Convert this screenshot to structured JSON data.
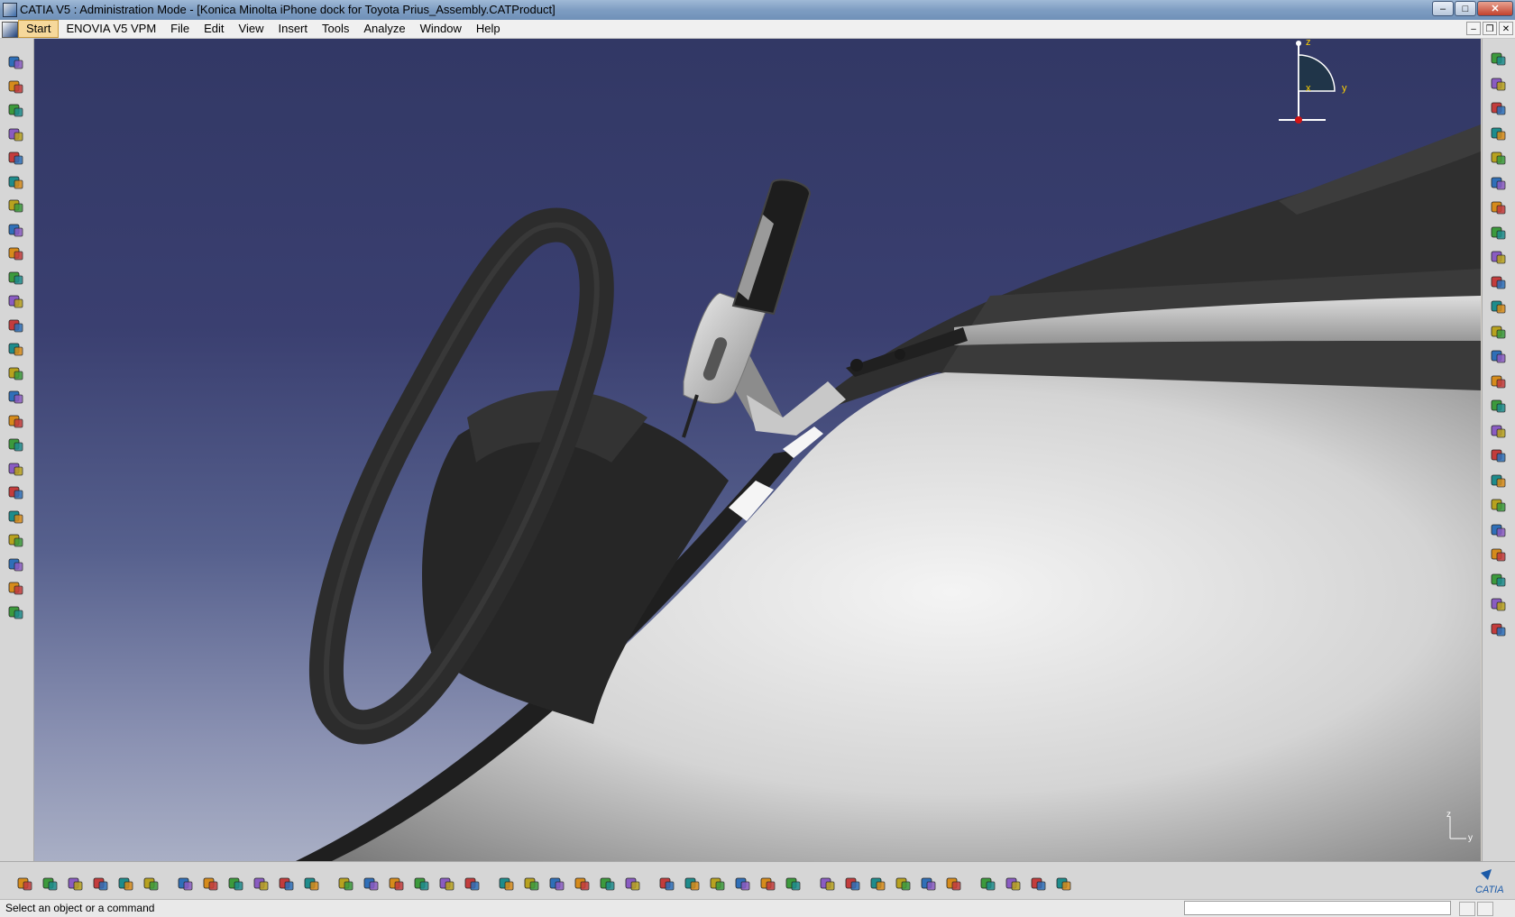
{
  "window": {
    "title": "CATIA V5 : Administration Mode - [Konica Minolta iPhone dock for Toyota Prius_Assembly.CATProduct]",
    "controls": {
      "minimize": "–",
      "maximize": "□",
      "close": "✕"
    }
  },
  "menu": {
    "items": [
      {
        "label": "Start"
      },
      {
        "label": "ENOVIA V5 VPM"
      },
      {
        "label": "File"
      },
      {
        "label": "Edit"
      },
      {
        "label": "View"
      },
      {
        "label": "Insert"
      },
      {
        "label": "Tools"
      },
      {
        "label": "Analyze"
      },
      {
        "label": "Window"
      },
      {
        "label": "Help"
      }
    ],
    "active": "Start",
    "doc_controls": {
      "minimize": "–",
      "restore": "❐",
      "close": "✕"
    }
  },
  "compass": {
    "axis_z": "z",
    "axis_x": "x",
    "axis_y": "y"
  },
  "mini_axis": {
    "z": "z",
    "y": "y"
  },
  "status": {
    "message": "Select an object or a command",
    "command_input": ""
  },
  "brand": {
    "logo_text": "CATIA"
  },
  "colors": {
    "background_top": "#323865",
    "background_bottom": "#a9afc5",
    "accent_menu": "#f6d89b",
    "toolbar": "#d6d6d6"
  },
  "left_tools": [
    "point-icon",
    "spline-icon",
    "sweep-icon",
    "eraser-icon",
    "product-icon",
    "component-icon",
    "existing-component-icon",
    "part-icon",
    "replace-icon",
    "reorder-icon",
    "ruler-icon",
    "measure-icon",
    "constraint-icon",
    "update-icon",
    "scene-icon",
    "dimension-icon",
    "text-icon",
    "flag-note-icon",
    "annotation-icon",
    "sectioning-icon",
    "catalog-icon",
    "bom-icon",
    "tree-icon",
    "links-icon"
  ],
  "right_tools": [
    "gear-icon",
    "select-arrow-icon",
    "fast-multi-instance-icon",
    "kinematics-icon",
    "assembly-icon",
    "mechanism-icon",
    "insert-icon",
    "publish-icon",
    "manipulation-icon",
    "snap-icon",
    "explode-icon",
    "smart-move-icon",
    "coincidence-icon",
    "contact-icon",
    "offset-icon",
    "angle-icon",
    "fix-icon",
    "fix-together-icon",
    "quick-constraint-icon",
    "flexible-icon",
    "reuse-pattern-icon",
    "space-analysis-icon",
    "clash-icon",
    "distance-icon"
  ],
  "bottom_tools": [
    "new-icon",
    "open-icon",
    "save-icon",
    "print-icon",
    "cut-icon",
    "copy-icon",
    "paste-icon",
    "undo-icon",
    "redo-icon",
    "whats-this-icon",
    "formula-icon",
    "comment-icon",
    "knowledge-icon",
    "table-icon",
    "design-table-icon",
    "lock-icon",
    "product-structure-icon",
    "fly-mode-icon",
    "fit-all-icon",
    "pan-icon",
    "rotate-icon",
    "zoom-in-icon",
    "zoom-out-icon",
    "normal-view-icon",
    "multi-view-icon",
    "isometric-view-icon",
    "hide-show-icon",
    "swap-visible-icon",
    "render-style-icon",
    "refresh-icon",
    "capture-icon",
    "sketch-icon",
    "grid-icon",
    "material-icon",
    "apply-material-icon",
    "lights-icon",
    "plane-icon",
    "measure-between-icon",
    "measure-item-icon",
    "measure-inertia-icon"
  ]
}
